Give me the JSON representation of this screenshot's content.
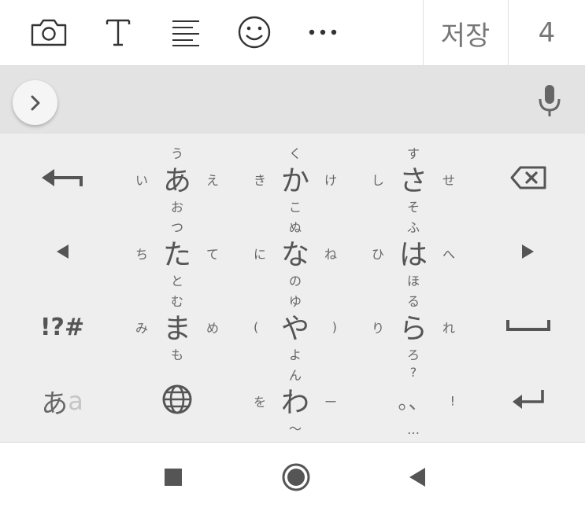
{
  "toolbar": {
    "icons": [
      "camera-icon",
      "text-style-icon",
      "align-icon",
      "emoji-icon",
      "more-icon"
    ],
    "save_label": "저장",
    "count": "4"
  },
  "suggestion_bar": {
    "expand_icon": "chevron-right-icon",
    "mic_icon": "microphone-icon"
  },
  "keyboard": {
    "colors": {
      "bg": "#eeeeee",
      "text": "#555555"
    },
    "left_column": {
      "undo_icon": "undo-arrow-icon",
      "cursor_left_icon": "cursor-left-icon",
      "symbols_label": "!?#",
      "mode_main": "あ",
      "mode_sub": "a"
    },
    "right_column": {
      "backspace_icon": "backspace-icon",
      "cursor_right_icon": "cursor-right-icon",
      "space_icon": "space-icon",
      "enter_icon": "enter-icon"
    },
    "globe_icon": "globe-icon",
    "keys": {
      "a": {
        "c": "あ",
        "u": "う",
        "d": "お",
        "l": "い",
        "r": "え"
      },
      "ka": {
        "c": "か",
        "u": "く",
        "d": "こ",
        "l": "き",
        "r": "け"
      },
      "sa": {
        "c": "さ",
        "u": "す",
        "d": "そ",
        "l": "し",
        "r": "せ"
      },
      "ta": {
        "c": "た",
        "u": "つ",
        "d": "と",
        "l": "ち",
        "r": "て"
      },
      "na": {
        "c": "な",
        "u": "ぬ",
        "d": "の",
        "l": "に",
        "r": "ね"
      },
      "ha": {
        "c": "は",
        "u": "ふ",
        "d": "ほ",
        "l": "ひ",
        "r": "へ"
      },
      "ma": {
        "c": "ま",
        "u": "む",
        "d": "も",
        "l": "み",
        "r": "め"
      },
      "ya": {
        "c": "や",
        "u": "ゆ",
        "d": "よ",
        "l": "(",
        "r": ")"
      },
      "ra": {
        "c": "ら",
        "u": "る",
        "d": "ろ",
        "l": "り",
        "r": "れ"
      },
      "wa": {
        "c": "わ",
        "u": "ん",
        "d": "〜",
        "l": "を",
        "r": "ー"
      },
      "punct": {
        "c": "。、",
        "u": "?",
        "d": "…",
        "l": "",
        "r": "!"
      }
    }
  },
  "navbar": {
    "icons": [
      "recents-square-icon",
      "home-circle-icon",
      "back-triangle-icon"
    ]
  }
}
